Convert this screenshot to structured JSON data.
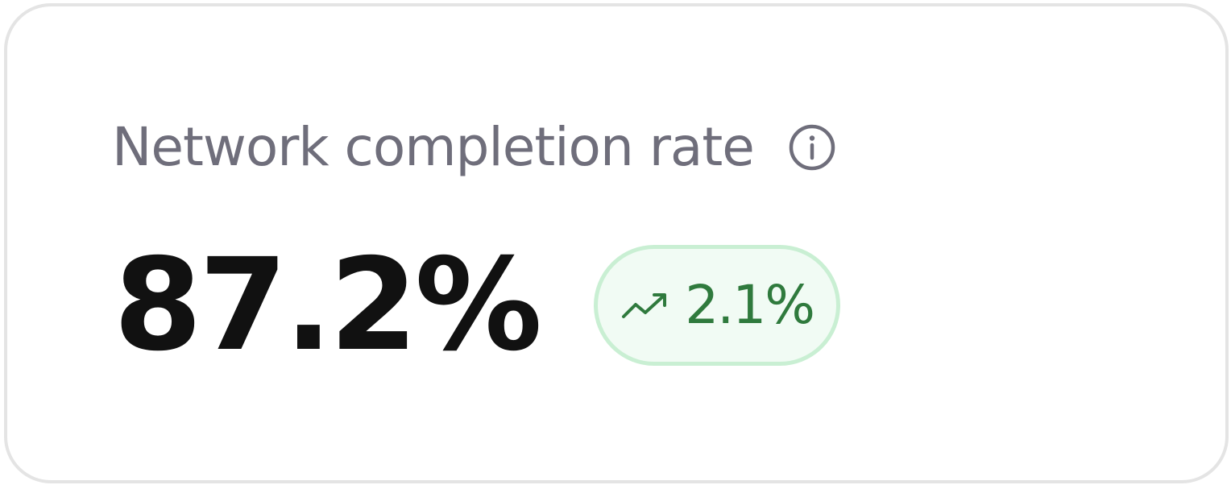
{
  "metric": {
    "title": "Network completion rate",
    "info_icon": "info-icon",
    "value": "87.2%",
    "change": {
      "text": "2.1%",
      "icon": "trend-up-icon",
      "direction": "up",
      "color": "#2f7a3d"
    }
  },
  "colors": {
    "card_border": "#e4e4e4",
    "title": "#6f6e7b",
    "value": "#111111",
    "badge_background": "#f1fbf4",
    "badge_border": "#c9efd3",
    "positive": "#2f7a3d"
  }
}
